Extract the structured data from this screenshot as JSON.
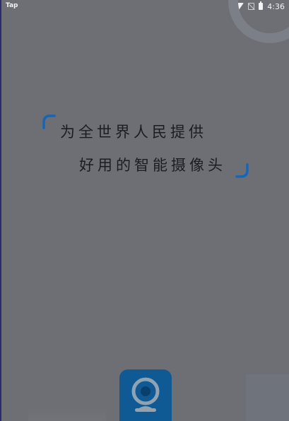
{
  "status_bar": {
    "carrier_label": "Tap",
    "time": "4:36",
    "icons": [
      "wifi-icon",
      "no-sim-icon",
      "battery-icon"
    ]
  },
  "slogan": {
    "line1": "为全世界人民提供",
    "line2": "好用的智能摄像头"
  },
  "app_icon": {
    "icon": "webcam-icon"
  },
  "colors": {
    "overlay_bg": "#6d6f74",
    "accent_blue": "#0f5a94",
    "bracket_blue": "#1466b8",
    "text": "#1b1d24"
  }
}
